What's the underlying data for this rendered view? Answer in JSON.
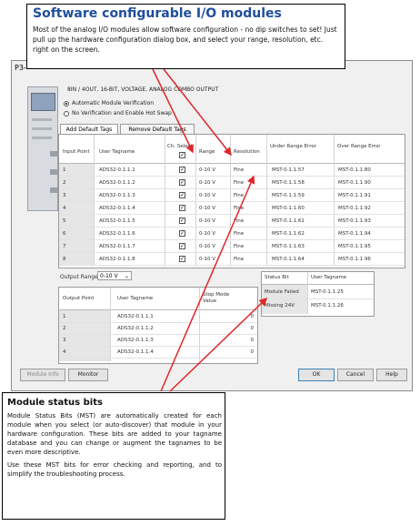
{
  "callout_top": {
    "title": "Software configurable I/O modules",
    "text": "Most of the analog I/O modules allow software configuration - no dip switches to set! Just pull up the hardware configuration dialog box, and select your range, resolution, etc. right on the screen."
  },
  "callout_bottom": {
    "title": "Module status bits",
    "text1": "Module Status Bits (MST) are automatically created for each module when you select (or auto-discover) that module in your hardware configuration. These bits are added to your tagname database and you can change or augment the tagnames to be even more descriptive.",
    "text2": "Use these MST bits for error checking and reporting, and to simplify the troubleshooting process."
  },
  "dialog": {
    "title": "P3-",
    "description": "8IN / 4OUT, 16-BIT, VOLTAGE, ANALOG COMBO OUTPUT",
    "radio_auto": "Automatic Module Verification",
    "radio_none": "No Verification and Enable Hot Swap",
    "tab_add": "Add Default Tags",
    "tab_remove": "Remove Default Tags",
    "input_headers": {
      "point": "Input Point",
      "tag": "User Tagname",
      "select": "Ch. Select",
      "range": "Range",
      "resolution": "Resolution",
      "under": "Under Range Error",
      "over": "Over Range Error"
    },
    "inputs": [
      {
        "point": "1",
        "tag": "ADS32-0.1.1.1",
        "range": "0-10 V",
        "res": "Fine",
        "under": "MST-0.1.1.57",
        "over": "MST-0.1.1.80"
      },
      {
        "point": "2",
        "tag": "ADS32-0.1.1.2",
        "range": "0-10 V",
        "res": "Fine",
        "under": "MST-0.1.1.58",
        "over": "MST-0.1.1.90"
      },
      {
        "point": "3",
        "tag": "ADS32-0.1.1.3",
        "range": "0-10 V",
        "res": "Fine",
        "under": "MST-0.1.1.59",
        "over": "MST-0.1.1.91"
      },
      {
        "point": "4",
        "tag": "ADS32-0.1.1.4",
        "range": "0-10 V",
        "res": "Fine",
        "under": "MST-0.1.1.60",
        "over": "MST-0.1.1.92"
      },
      {
        "point": "5",
        "tag": "ADS32-0.1.1.5",
        "range": "0-10 V",
        "res": "Fine",
        "under": "MST-0.1.1.61",
        "over": "MST-0.1.1.93"
      },
      {
        "point": "6",
        "tag": "ADS32-0.1.1.6",
        "range": "0-10 V",
        "res": "Fine",
        "under": "MST-0.1.1.62",
        "over": "MST-0.1.1.94"
      },
      {
        "point": "7",
        "tag": "ADS32-0.1.1.7",
        "range": "0-10 V",
        "res": "Fine",
        "under": "MST-0.1.1.63",
        "over": "MST-0.1.1.95"
      },
      {
        "point": "8",
        "tag": "ADS32-0.1.1.8",
        "range": "0-10 V",
        "res": "Fine",
        "under": "MST-0.1.1.64",
        "over": "MST-0.1.1.96"
      }
    ],
    "output_range_label": "Output Range",
    "output_range_value": "0-10 V",
    "output_headers": {
      "point": "Output Point",
      "tag": "User Tagname",
      "stop": "Stop Mode Value"
    },
    "outputs": [
      {
        "point": "1",
        "tag": "ADS32-0.1.1.1",
        "stop": "0"
      },
      {
        "point": "2",
        "tag": "ADS32-0.1.1.2",
        "stop": "0"
      },
      {
        "point": "3",
        "tag": "ADS32-0.1.1.3",
        "stop": "0"
      },
      {
        "point": "4",
        "tag": "ADS32-0.1.1.4",
        "stop": "0"
      }
    ],
    "status_headers": {
      "bit": "Status Bit",
      "tag": "User Tagname"
    },
    "status": [
      {
        "bit": "Module Failed",
        "tag": "MST-0.1.1.25"
      },
      {
        "bit": "Missing 24V",
        "tag": "MST-0.1.1.26"
      }
    ],
    "buttons": {
      "module_info": "Module Info",
      "monitor": "Monitor",
      "ok": "OK",
      "cancel": "Cancel",
      "help": "Help"
    }
  }
}
